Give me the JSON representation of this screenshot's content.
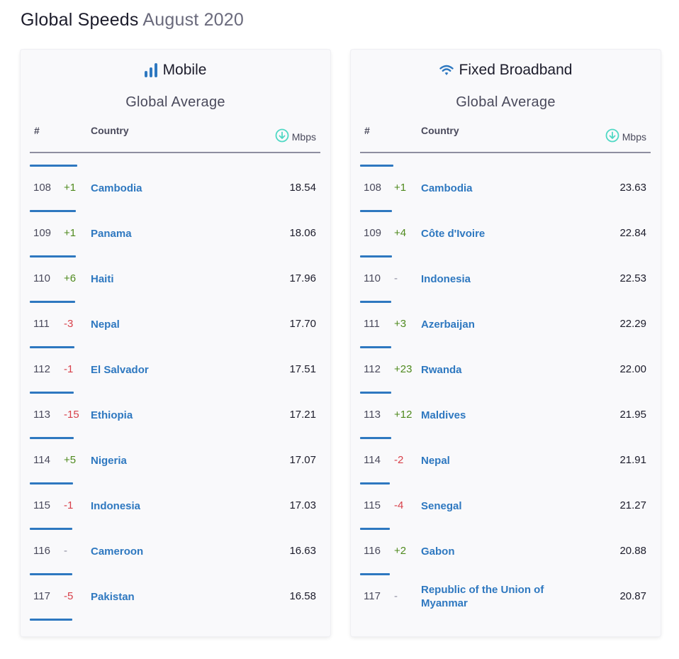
{
  "page": {
    "title": "Global Speeds",
    "subtitle": "August 2020"
  },
  "colors": {
    "accent_blue": "#2e78c0",
    "positive_change": "#4f8a1e",
    "negative_change": "#d8404a",
    "download_icon": "#4fd8c4"
  },
  "mobile": {
    "title": "Mobile",
    "icon": "signal-bars-icon",
    "subtitle": "Global Average",
    "headers": {
      "rank": "#",
      "country": "Country",
      "speed": "Mbps",
      "speed_icon": "download-arrow-icon"
    },
    "bar_scale_max": 113.6,
    "trailing_bar_value": 16.5,
    "rows": [
      {
        "rank": "108",
        "change": "+1",
        "dir": "up",
        "country": "Cambodia",
        "speed": "18.54"
      },
      {
        "rank": "109",
        "change": "+1",
        "dir": "up",
        "country": "Panama",
        "speed": "18.06"
      },
      {
        "rank": "110",
        "change": "+6",
        "dir": "up",
        "country": "Haiti",
        "speed": "17.96"
      },
      {
        "rank": "111",
        "change": "-3",
        "dir": "down",
        "country": "Nepal",
        "speed": "17.70"
      },
      {
        "rank": "112",
        "change": "-1",
        "dir": "down",
        "country": "El Salvador",
        "speed": "17.51"
      },
      {
        "rank": "113",
        "change": "-15",
        "dir": "down",
        "country": "Ethiopia",
        "speed": "17.21"
      },
      {
        "rank": "114",
        "change": "+5",
        "dir": "up",
        "country": "Nigeria",
        "speed": "17.07"
      },
      {
        "rank": "115",
        "change": "-1",
        "dir": "down",
        "country": "Indonesia",
        "speed": "17.03"
      },
      {
        "rank": "116",
        "change": "-",
        "dir": "same",
        "country": "Cameroon",
        "speed": "16.63"
      },
      {
        "rank": "117",
        "change": "-5",
        "dir": "down",
        "country": "Pakistan",
        "speed": "16.58"
      }
    ]
  },
  "fixed": {
    "title": "Fixed Broadband",
    "icon": "wifi-icon",
    "subtitle": "Global Average",
    "headers": {
      "rank": "#",
      "country": "Country",
      "speed": "Mbps",
      "speed_icon": "download-arrow-icon"
    },
    "bar_scale_max": 206.0,
    "rows": [
      {
        "rank": "108",
        "change": "+1",
        "dir": "up",
        "country": "Cambodia",
        "speed": "23.63"
      },
      {
        "rank": "109",
        "change": "+4",
        "dir": "up",
        "country": "Côte d'Ivoire",
        "speed": "22.84"
      },
      {
        "rank": "110",
        "change": "-",
        "dir": "same",
        "country": "Indonesia",
        "speed": "22.53"
      },
      {
        "rank": "111",
        "change": "+3",
        "dir": "up",
        "country": "Azerbaijan",
        "speed": "22.29"
      },
      {
        "rank": "112",
        "change": "+23",
        "dir": "up",
        "country": "Rwanda",
        "speed": "22.00"
      },
      {
        "rank": "113",
        "change": "+12",
        "dir": "up",
        "country": "Maldives",
        "speed": "21.95"
      },
      {
        "rank": "114",
        "change": "-2",
        "dir": "down",
        "country": "Nepal",
        "speed": "21.91"
      },
      {
        "rank": "115",
        "change": "-4",
        "dir": "down",
        "country": "Senegal",
        "speed": "21.27"
      },
      {
        "rank": "116",
        "change": "+2",
        "dir": "up",
        "country": "Gabon",
        "speed": "20.88"
      },
      {
        "rank": "117",
        "change": "-",
        "dir": "same",
        "country": "Republic of the Union of Myanmar",
        "speed": "20.87"
      }
    ]
  }
}
